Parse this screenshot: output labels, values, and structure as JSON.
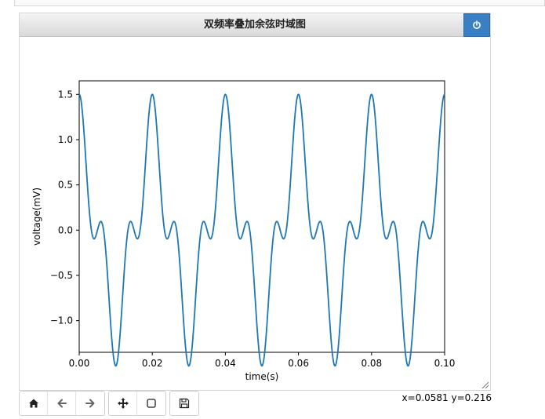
{
  "figure": {
    "title": "双频率叠加余弦时域图"
  },
  "toolbar": {
    "buttons": [
      {
        "name": "home-icon"
      },
      {
        "name": "back-arrow-icon"
      },
      {
        "name": "forward-arrow-icon"
      },
      {
        "name": "pan-move-icon"
      },
      {
        "name": "zoom-rect-icon"
      },
      {
        "name": "save-disk-icon"
      }
    ]
  },
  "status": {
    "coords": "x=0.0581 y=0.216"
  },
  "colors": {
    "line": "#1f77b4",
    "close_button": "#3a7fc4"
  },
  "chart_data": {
    "type": "line",
    "xlabel": "time(s)",
    "ylabel": "voltage(mV)",
    "xlim": [
      0.0,
      0.1
    ],
    "ylim": [
      -1.35,
      1.65
    ],
    "xticks": [
      "0.00",
      "0.02",
      "0.04",
      "0.06",
      "0.08",
      "0.10"
    ],
    "yticks": [
      "−1.0",
      "−0.5",
      "0.0",
      "0.5",
      "1.0",
      "1.5"
    ],
    "series": [
      {
        "formula": "cos(2π·50·t) + 0.5·cos(2π·150·t)",
        "t_range": [
          0.0,
          0.1
        ],
        "samples": 1000
      }
    ],
    "grid": false
  }
}
